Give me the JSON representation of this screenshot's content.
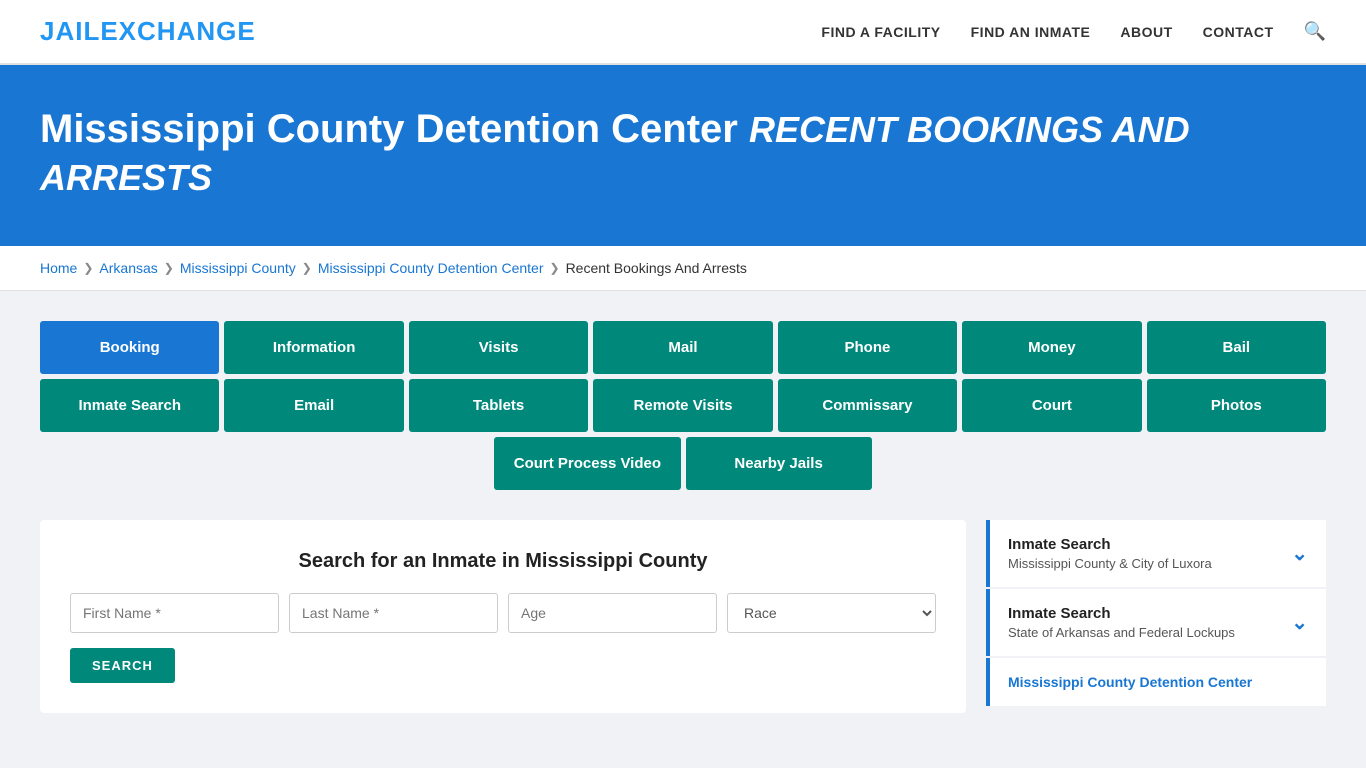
{
  "header": {
    "logo_part1": "JAIL",
    "logo_part2": "EXCHANGE",
    "nav_items": [
      {
        "label": "FIND A FACILITY",
        "id": "find-facility"
      },
      {
        "label": "FIND AN INMATE",
        "id": "find-inmate"
      },
      {
        "label": "ABOUT",
        "id": "about"
      },
      {
        "label": "CONTACT",
        "id": "contact"
      }
    ]
  },
  "hero": {
    "title_main": "Mississippi County Detention Center",
    "title_italic": "RECENT BOOKINGS AND ARRESTS"
  },
  "breadcrumb": {
    "items": [
      {
        "label": "Home",
        "id": "bc-home"
      },
      {
        "label": "Arkansas",
        "id": "bc-arkansas"
      },
      {
        "label": "Mississippi County",
        "id": "bc-ms-county"
      },
      {
        "label": "Mississippi County Detention Center",
        "id": "bc-ms-dc"
      },
      {
        "label": "Recent Bookings And Arrests",
        "id": "bc-current"
      }
    ]
  },
  "tabs_row1": [
    {
      "label": "Booking",
      "active": true,
      "id": "tab-booking"
    },
    {
      "label": "Information",
      "active": false,
      "id": "tab-information"
    },
    {
      "label": "Visits",
      "active": false,
      "id": "tab-visits"
    },
    {
      "label": "Mail",
      "active": false,
      "id": "tab-mail"
    },
    {
      "label": "Phone",
      "active": false,
      "id": "tab-phone"
    },
    {
      "label": "Money",
      "active": false,
      "id": "tab-money"
    },
    {
      "label": "Bail",
      "active": false,
      "id": "tab-bail"
    }
  ],
  "tabs_row2": [
    {
      "label": "Inmate Search",
      "active": false,
      "id": "tab-inmate-search"
    },
    {
      "label": "Email",
      "active": false,
      "id": "tab-email"
    },
    {
      "label": "Tablets",
      "active": false,
      "id": "tab-tablets"
    },
    {
      "label": "Remote Visits",
      "active": false,
      "id": "tab-remote-visits"
    },
    {
      "label": "Commissary",
      "active": false,
      "id": "tab-commissary"
    },
    {
      "label": "Court",
      "active": false,
      "id": "tab-court"
    },
    {
      "label": "Photos",
      "active": false,
      "id": "tab-photos"
    }
  ],
  "tabs_row3": [
    {
      "label": "Court Process Video",
      "active": false,
      "id": "tab-court-process-video"
    },
    {
      "label": "Nearby Jails",
      "active": false,
      "id": "tab-nearby-jails"
    }
  ],
  "search_section": {
    "title": "Search for an Inmate in Mississippi County",
    "first_name_placeholder": "First Name *",
    "last_name_placeholder": "Last Name *",
    "age_placeholder": "Age",
    "race_placeholder": "Race",
    "search_btn_label": "SEARCH"
  },
  "sidebar": {
    "items": [
      {
        "title": "Inmate Search",
        "subtitle": "Mississippi County & City of Luxora",
        "id": "sidebar-inmate-search-ms"
      },
      {
        "title": "Inmate Search",
        "subtitle": "State of Arkansas and Federal Lockups",
        "id": "sidebar-inmate-search-ar"
      }
    ],
    "plain_item": {
      "label": "Mississippi County Detention Center",
      "id": "sidebar-ms-dc"
    }
  }
}
